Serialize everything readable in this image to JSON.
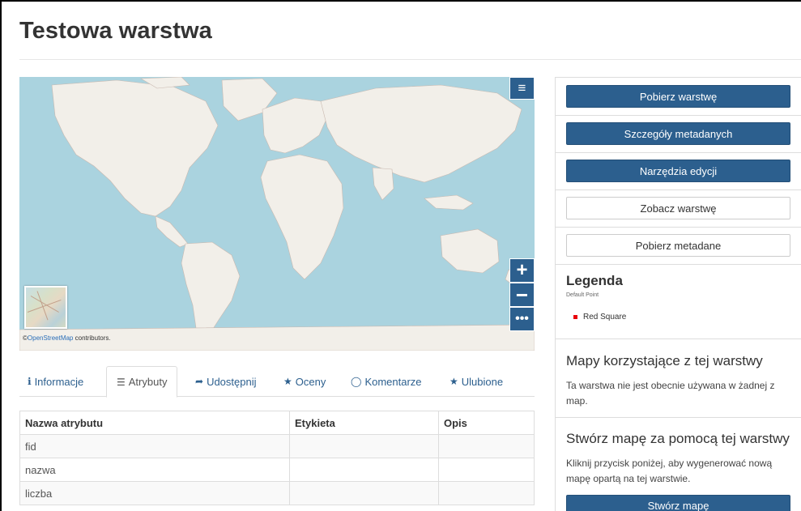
{
  "page": {
    "title": "Testowa warstwa"
  },
  "map": {
    "menu_icon": "hamburger-icon",
    "zoom_in": "+",
    "zoom_out": "−",
    "more": "•••",
    "attribution_prefix": "©",
    "attribution_link": "OpenStreetMap",
    "attribution_suffix": " contributors.",
    "colors": {
      "water": "#aad3df",
      "land": "#f2efe9",
      "control": "#2c5f8e"
    }
  },
  "tabs": [
    {
      "icon": "info-circle-icon",
      "glyph": "ℹ",
      "label": "Informacje",
      "active": false
    },
    {
      "icon": "list-icon",
      "glyph": "☰",
      "label": "Atrybuty",
      "active": true
    },
    {
      "icon": "share-icon",
      "glyph": "➦",
      "label": "Udostępnij",
      "active": false
    },
    {
      "icon": "star-icon",
      "glyph": "★",
      "label": "Oceny",
      "active": false
    },
    {
      "icon": "comment-icon",
      "glyph": "◯",
      "label": "Komentarze",
      "active": false
    },
    {
      "icon": "star-icon",
      "glyph": "★",
      "label": "Ulubione",
      "active": false
    }
  ],
  "attributes": {
    "headers": [
      "Nazwa atrybutu",
      "Etykieta",
      "Opis"
    ],
    "rows": [
      [
        "fid",
        "",
        ""
      ],
      [
        "nazwa",
        "",
        ""
      ],
      [
        "liczba",
        "",
        ""
      ]
    ]
  },
  "sidebar": {
    "buttons": [
      {
        "label": "Pobierz warstwę",
        "style": "primary"
      },
      {
        "label": "Szczegóły metadanych",
        "style": "primary"
      },
      {
        "label": "Narzędzia edycji",
        "style": "primary"
      },
      {
        "label": "Zobacz warstwę",
        "style": "default"
      },
      {
        "label": "Pobierz metadane",
        "style": "default"
      }
    ],
    "legend": {
      "title": "Legenda",
      "subtitle": "Default Point",
      "item_label": "Red Square",
      "item_color": "#e8000b"
    },
    "maps_using": {
      "title": "Mapy korzystające z tej warstwy",
      "text": "Ta warstwa nie jest obecnie używana w żadnej z map."
    },
    "create_map": {
      "title": "Stwórz mapę za pomocą tej warstwy",
      "text": "Kliknij przycisk poniżej, aby wygenerować nową mapę opartą na tej warstwie.",
      "button_label": "Stwórz mapę"
    }
  }
}
